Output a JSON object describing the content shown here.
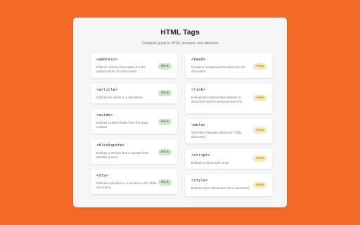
{
  "header": {
    "title": "HTML Tags",
    "subtitle": "Complete guide to HTML elements and attributes"
  },
  "left_column": [
    {
      "tag": "<address>",
      "desc": "Defines contact information for the author/owner of a document",
      "badge": "block"
    },
    {
      "tag": "<article>",
      "desc": "Defines an article in a document",
      "badge": "block"
    },
    {
      "tag": "<aside>",
      "desc": "Defines content aside from the page content",
      "badge": "block"
    },
    {
      "tag": "<blockquote>",
      "desc": "Defines a section that is quoted from another source",
      "badge": "block"
    },
    {
      "tag": "<div>",
      "desc": "Defines a division or a section in an HTML document",
      "badge": "block"
    }
  ],
  "right_column": [
    {
      "tag": "<head>",
      "desc": "Contains metadata/information for the document",
      "badge": "meta"
    },
    {
      "tag": "<link>",
      "desc": "Defines the relationship between a document and an external resource",
      "badge": "meta"
    },
    {
      "tag": "<meta>",
      "desc": "Specifies metadata about an HTML document",
      "badge": "meta"
    },
    {
      "tag": "<script>",
      "desc": "Defines a client-side script",
      "badge": "meta"
    },
    {
      "tag": "<style>",
      "desc": "Defines style information for a document",
      "badge": "meta"
    }
  ],
  "colors": {
    "background": "#f26a26",
    "block_badge": "#cfe8cf",
    "meta_badge": "#fbeab8"
  }
}
